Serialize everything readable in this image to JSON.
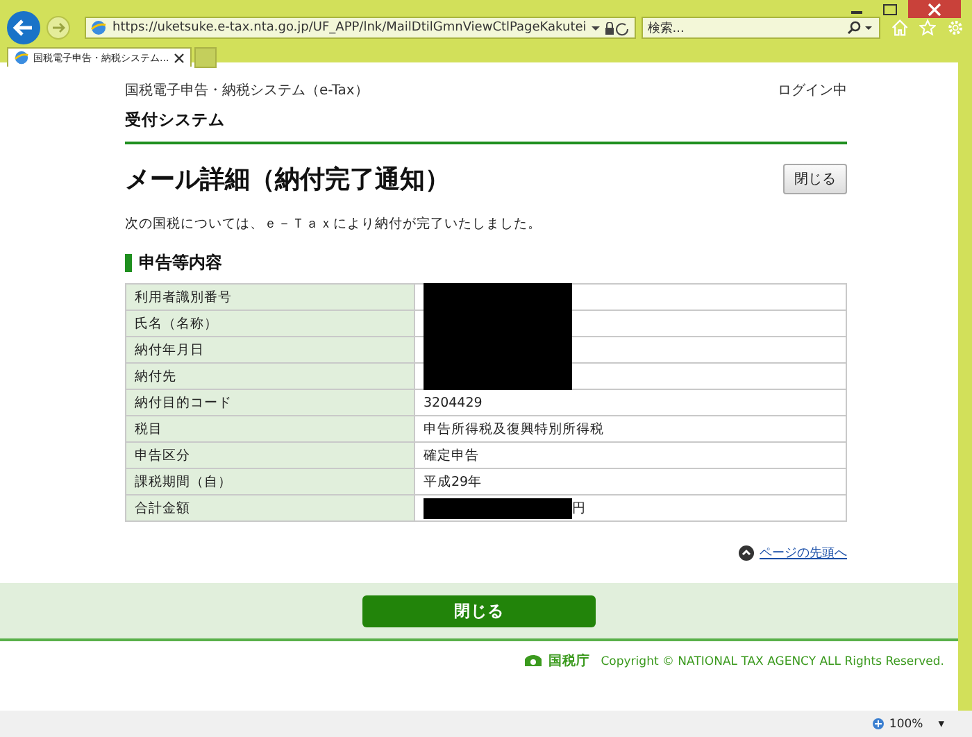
{
  "browser": {
    "url": "https://uketsuke.e-tax.nta.go.jp/UF_APP/lnk/MailDtilGmnViewCtlPageKakutei",
    "search_placeholder": "検索...",
    "tab_title": "国税電子申告・納税システム...",
    "zoom": "100%",
    "zoom_menu": "▾"
  },
  "header": {
    "system": "国税電子申告・納税システム（e-Tax）",
    "status": "ログイン中",
    "subsystem": "受付システム"
  },
  "title": "メール詳細（納付完了通知）",
  "close_button_top": "閉じる",
  "message": "次の国税については、ｅ－Ｔａｘにより納付が完了いたしました。",
  "section_heading": "申告等内容",
  "rows": [
    {
      "label": "利用者識別番号",
      "redacted": true
    },
    {
      "label": "氏名（名称）",
      "redacted": true
    },
    {
      "label": "納付年月日",
      "redacted": true
    },
    {
      "label": "納付先",
      "redacted": true
    },
    {
      "label": "納付目的コード",
      "value": "3204429",
      "redacted": false
    },
    {
      "label": "税目",
      "value": "申告所得税及復興特別所得税",
      "redacted": false
    },
    {
      "label": "申告区分",
      "value": "確定申告",
      "redacted": false
    },
    {
      "label": "課税期間（自）",
      "value": "平成29年",
      "redacted": false
    },
    {
      "label": "合計金額",
      "value": "円",
      "redacted": true
    }
  ],
  "page_top_link": "ページの先頭へ",
  "close_button_bottom": "閉じる",
  "footer": {
    "agency": "国税庁",
    "copyright": "Copyright © NATIONAL TAX AGENCY ALL Rights Reserved."
  }
}
